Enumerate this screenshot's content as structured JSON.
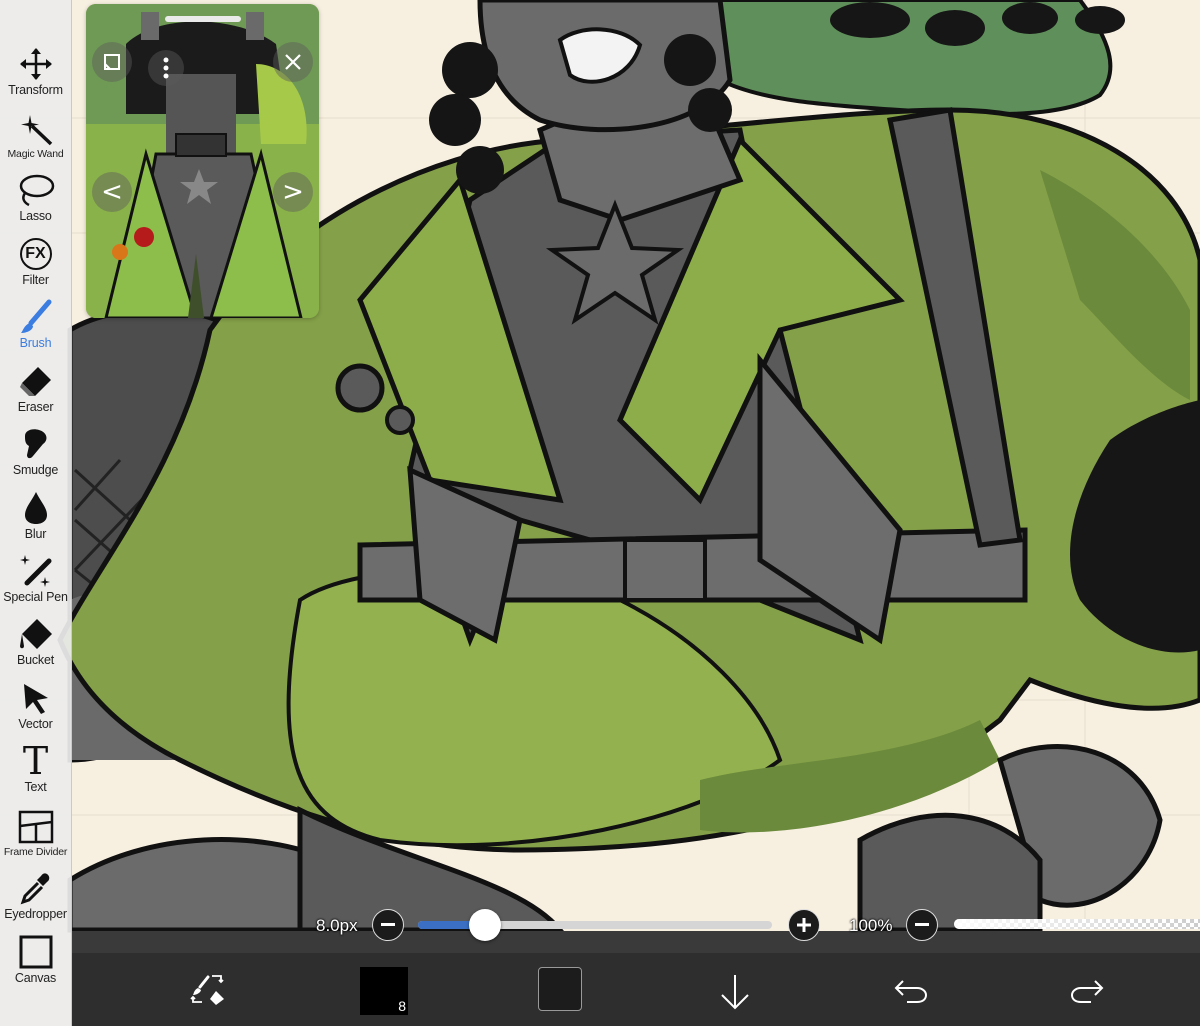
{
  "toolbar": {
    "tools": [
      {
        "label": "Transform",
        "icon": "transform-icon"
      },
      {
        "label": "Magic Wand",
        "icon": "magic-wand-icon"
      },
      {
        "label": "Lasso",
        "icon": "lasso-icon"
      },
      {
        "label": "Filter",
        "icon": "fx-icon",
        "glyph": "FX"
      },
      {
        "label": "Brush",
        "icon": "brush-icon",
        "active": true
      },
      {
        "label": "Eraser",
        "icon": "eraser-icon"
      },
      {
        "label": "Smudge",
        "icon": "smudge-icon"
      },
      {
        "label": "Blur",
        "icon": "drop-icon"
      },
      {
        "label": "Special Pen",
        "icon": "special-pen-icon"
      },
      {
        "label": "Bucket",
        "icon": "bucket-icon"
      },
      {
        "label": "Vector",
        "icon": "vector-icon"
      },
      {
        "label": "Text",
        "icon": "text-icon",
        "glyph": "T"
      },
      {
        "label": "Frame Divider",
        "icon": "frame-divider-icon"
      },
      {
        "label": "Eyedropper",
        "icon": "eyedropper-icon"
      },
      {
        "label": "Canvas",
        "icon": "canvas-icon"
      }
    ],
    "active_color": "#3b7de0"
  },
  "reference_window": {
    "prev_glyph": "<",
    "next_glyph": ">"
  },
  "brush_size": {
    "value_label": "8.0px",
    "fill_fraction": 0.19
  },
  "opacity": {
    "value_label": "100%",
    "fill_fraction": 1.0
  },
  "bottom_bar": {
    "brush_size_badge": "8",
    "primary_color": "#000000",
    "layer_thumb_color": "#1c1c1c"
  },
  "colors": {
    "canvas_bg": "#f7efe0",
    "jacket_green": "#84a048",
    "shirt_gray": "#5a5a5a",
    "accent_blue": "#3a6fc4"
  }
}
